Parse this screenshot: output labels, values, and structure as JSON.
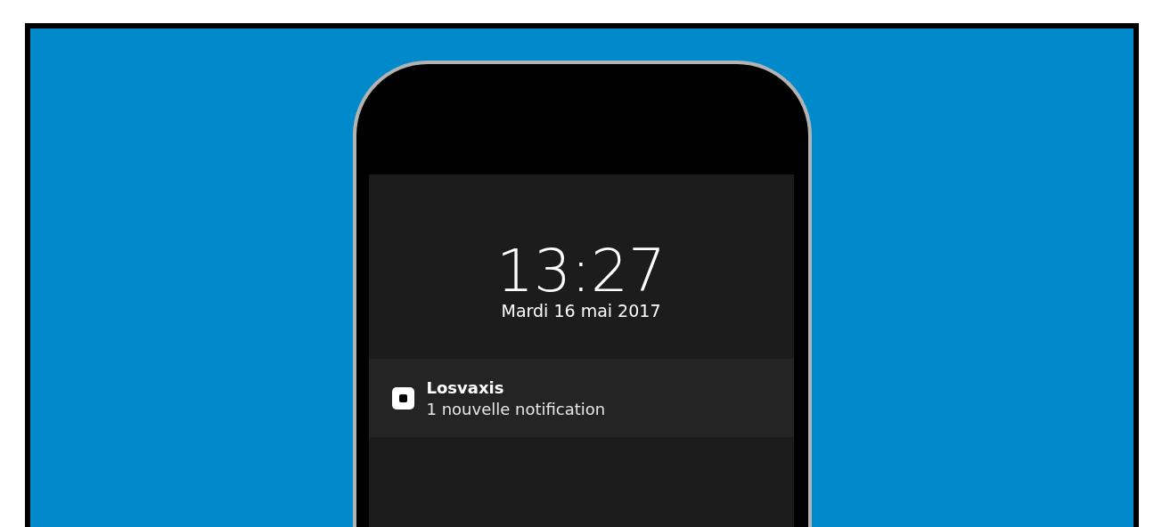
{
  "lock_screen": {
    "time": "13:27",
    "date": "Mardi 16 mai 2017"
  },
  "notifications": [
    {
      "app": "Losvaxis",
      "message": "1 nouvelle notification"
    }
  ]
}
